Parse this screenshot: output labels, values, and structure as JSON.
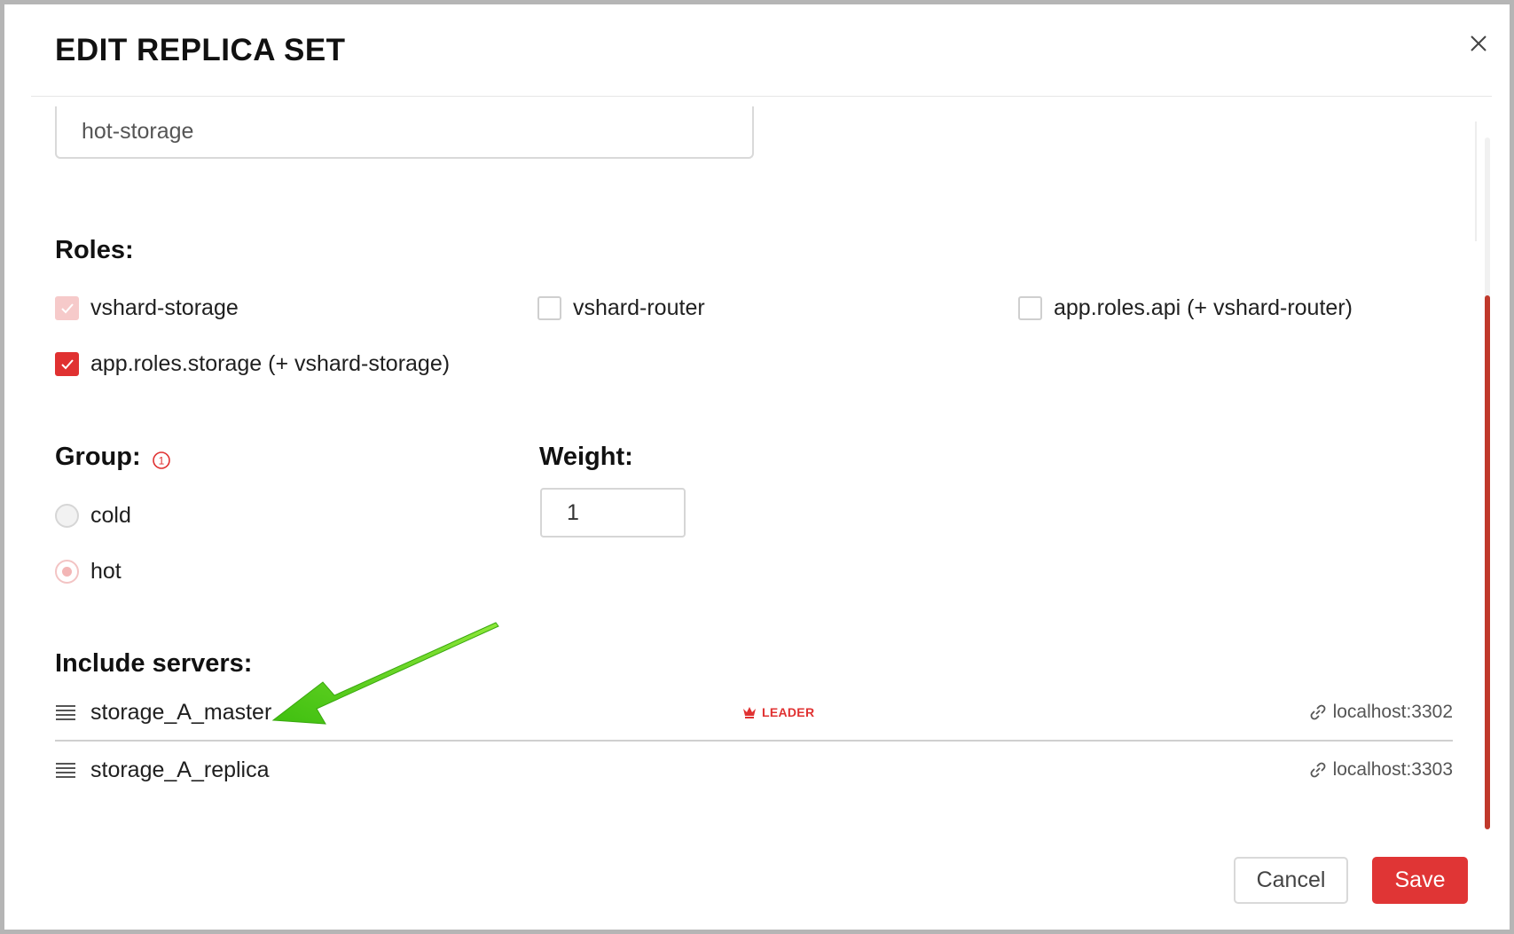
{
  "dialog": {
    "title": "EDIT REPLICA SET",
    "close_icon": "close-icon"
  },
  "alias": {
    "value": "hot-storage"
  },
  "roles": {
    "label": "Roles:",
    "items": [
      {
        "label": "vshard-storage",
        "state": "checked-disabled"
      },
      {
        "label": "vshard-router",
        "state": "unchecked"
      },
      {
        "label": "app.roles.api (+ vshard-router)",
        "state": "unchecked"
      },
      {
        "label": "app.roles.storage (+ vshard-storage)",
        "state": "checked"
      }
    ]
  },
  "group": {
    "label": "Group:",
    "info_icon": "info-icon",
    "options": [
      {
        "label": "cold",
        "selected": false
      },
      {
        "label": "hot",
        "selected": true
      }
    ]
  },
  "weight": {
    "label": "Weight:",
    "value": "1"
  },
  "servers": {
    "label": "Include servers:",
    "items": [
      {
        "name": "storage_A_master",
        "badge": "LEADER",
        "uri": "localhost:3302"
      },
      {
        "name": "storage_A_replica",
        "badge": "",
        "uri": "localhost:3303"
      }
    ]
  },
  "footer": {
    "cancel_label": "Cancel",
    "save_label": "Save"
  },
  "colors": {
    "accent": "#e03131",
    "annotation_arrow": "#5bd61e"
  }
}
